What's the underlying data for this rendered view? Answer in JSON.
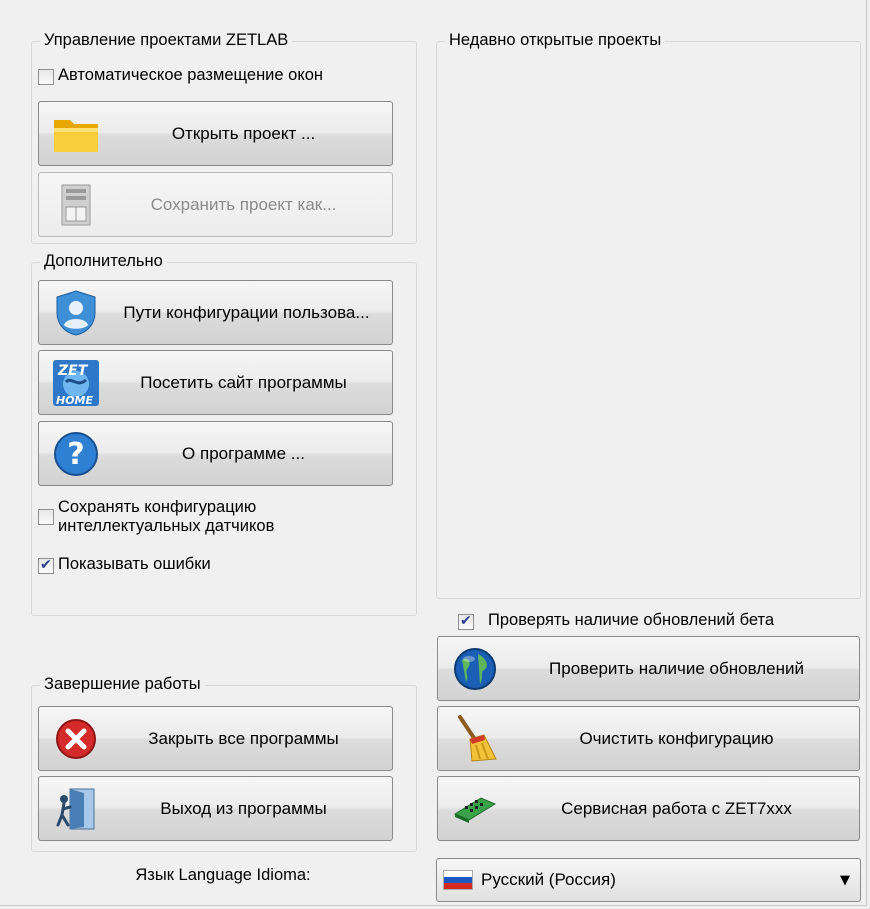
{
  "project_mgmt": {
    "title": "Управление проектами ZETLAB",
    "auto_arrange_label": "Автоматическое размещение окон",
    "auto_arrange_checked": false,
    "open_label": "Открыть проект ...",
    "save_as_label": "Сохранить проект как...",
    "save_as_enabled": false
  },
  "additional": {
    "title": "Дополнительно",
    "user_paths_label": "Пути конфигурации пользова...",
    "visit_site_label": "Посетить сайт программы",
    "about_label": "О программе ...",
    "save_sensor_config_label_line1": "Сохранять конфигурацию",
    "save_sensor_config_label_line2": "интеллектуальных датчиков",
    "save_sensor_config_checked": false,
    "show_errors_label": "Показывать ошибки",
    "show_errors_checked": true,
    "zet_icon_text_top": "ZET",
    "zet_icon_text_bottom": "HOME"
  },
  "recent": {
    "title": "Недавно открытые проекты",
    "items": []
  },
  "shutdown": {
    "title": "Завершение работы",
    "close_all_label": "Закрыть все программы",
    "exit_label": "Выход из программы"
  },
  "updates": {
    "check_beta_label": "Проверять наличие обновлений бета",
    "check_beta_checked": true,
    "check_updates_label": "Проверить наличие обновлений",
    "clear_config_label": "Очистить конфигурацию",
    "service_label": "Сервисная работа с ZET7xxx"
  },
  "language": {
    "label": "Язык Language Idioma:",
    "selected": "Русский (Россия)"
  },
  "colors": {
    "window_bg": "#f0f0f0",
    "folder": "#f5c518",
    "error_red": "#d42a2a",
    "globe_blue": "#1a5fb4"
  }
}
